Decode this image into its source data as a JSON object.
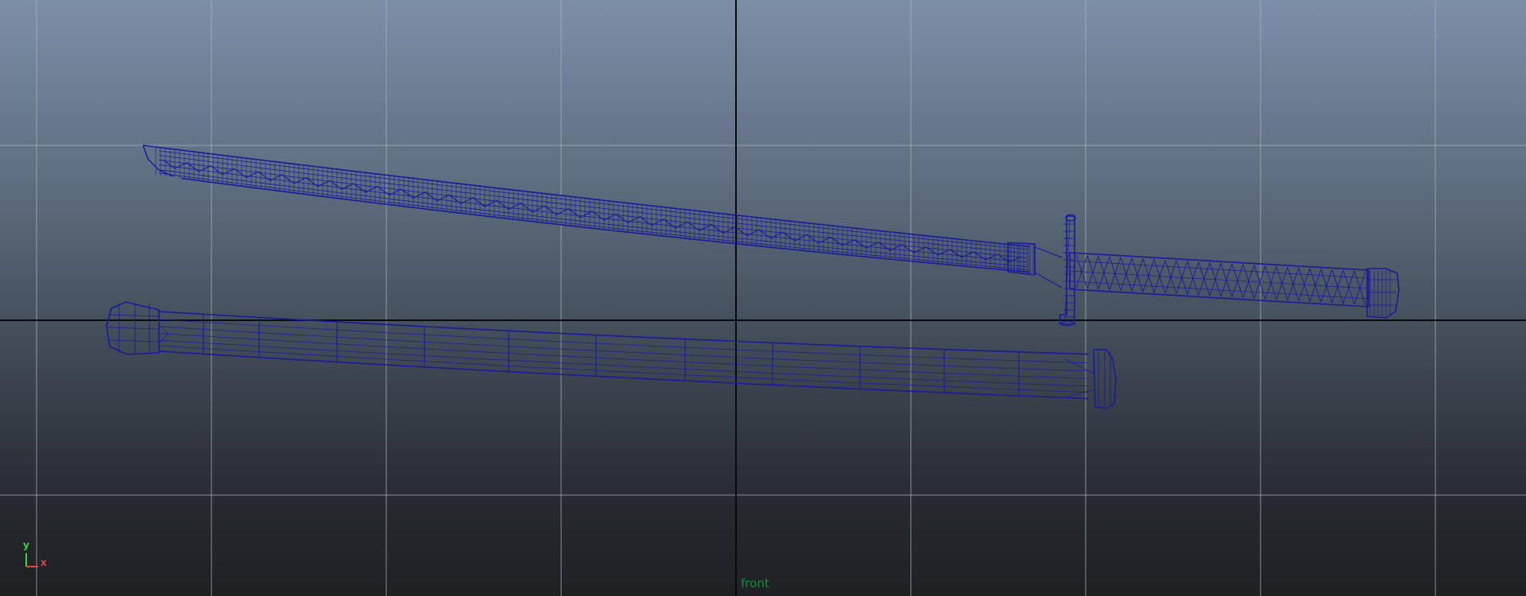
{
  "viewport": {
    "camera_name": "front",
    "background_top": "#7d8ea7",
    "background_bottom": "#1e2024",
    "grid_color": "#aab2bc",
    "axis_line_color": "#0a0a0a",
    "wire_color": "#1a1a9a",
    "view_label_color": "#1a8a3a"
  },
  "axis_gizmo": {
    "y_label": "y",
    "x_label": "x",
    "y_color": "#3ed24a",
    "x_color": "#e24545"
  },
  "objects": [
    {
      "name": "katana-blade",
      "shading": "wireframe"
    },
    {
      "name": "katana-tsuba",
      "shading": "wireframe"
    },
    {
      "name": "katana-handle",
      "shading": "wireframe"
    },
    {
      "name": "katana-scabbard",
      "shading": "wireframe"
    }
  ]
}
